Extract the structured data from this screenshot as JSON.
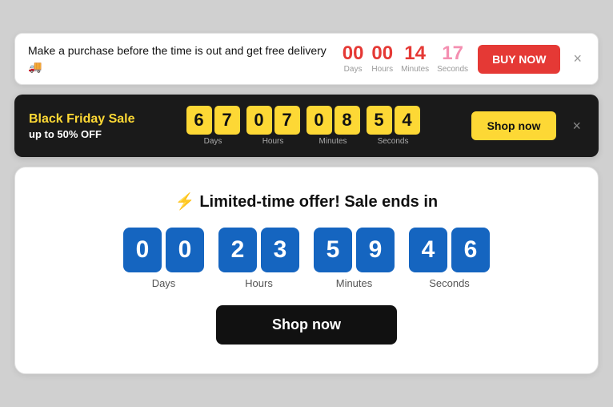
{
  "banner1": {
    "text": "Make a purchase before the time is out and get free delivery 🚚",
    "countdown": {
      "days": {
        "value": "00",
        "label": "Days"
      },
      "hours": {
        "value": "00",
        "label": "Hours"
      },
      "minutes": {
        "value": "14",
        "label": "Minutes"
      },
      "seconds": {
        "value": "17",
        "label": "Seconds"
      }
    },
    "buy_button": "BUY NOW",
    "close": "×"
  },
  "banner2": {
    "title": "Black Friday Sale",
    "subtitle": "up to 50% OFF",
    "countdown": {
      "days": {
        "d1": "6",
        "d2": "7",
        "label": "Days"
      },
      "hours": {
        "d1": "0",
        "d2": "7",
        "label": "Hours"
      },
      "minutes": {
        "d1": "0",
        "d2": "8",
        "label": "Minutes"
      },
      "seconds": {
        "d1": "5",
        "d2": "4",
        "label": "Seconds"
      }
    },
    "shop_button": "Shop now",
    "close": "×"
  },
  "banner3": {
    "icon": "⚡",
    "title": "Limited-time offer! Sale ends in",
    "countdown": {
      "days": {
        "d1": "0",
        "d2": "0",
        "label": "Days"
      },
      "hours": {
        "d1": "2",
        "d2": "3",
        "label": "Hours"
      },
      "minutes": {
        "d1": "5",
        "d2": "9",
        "label": "Minutes"
      },
      "seconds": {
        "d1": "4",
        "d2": "6",
        "label": "Seconds"
      }
    },
    "shop_button": "Shop now"
  }
}
